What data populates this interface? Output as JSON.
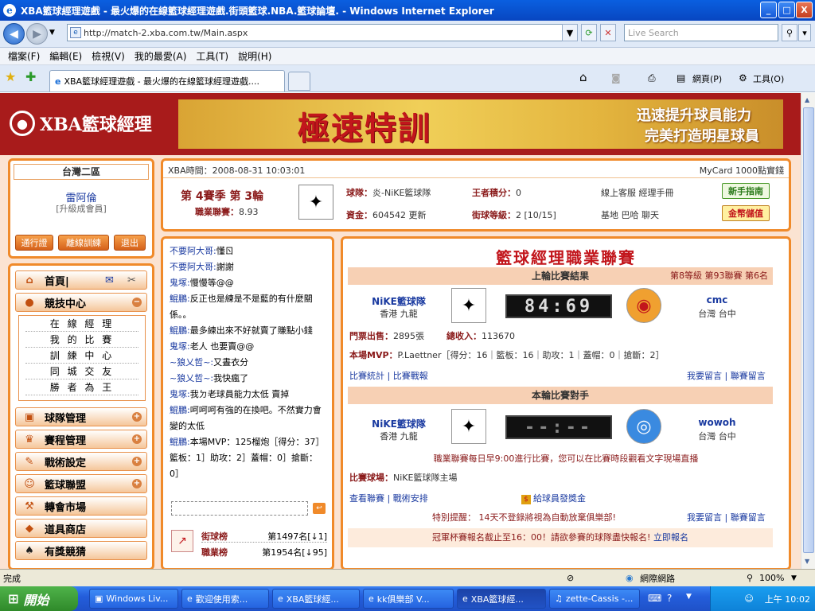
{
  "window": {
    "title": "XBA籃球經理遊戲 - 最火爆的在線籃球經理遊戲.街頭籃球.NBA.籃球論壇. - Windows Internet Explorer",
    "min": "_",
    "max": "□",
    "close": "X"
  },
  "address": {
    "url": "http://match-2.xba.com.tw/Main.aspx",
    "search_placeholder": "Live Search"
  },
  "menubar": [
    "檔案(F)",
    "編輯(E)",
    "檢視(V)",
    "我的最愛(A)",
    "工具(T)",
    "說明(H)"
  ],
  "tab": {
    "label": "XBA籃球經理遊戲 - 最火爆的在線籃球經理遊戲...."
  },
  "toolbar": {
    "page": "網頁(P)",
    "tools": "工具(O)"
  },
  "header": {
    "logo": "XBA籃球經理",
    "banner_main": "極速特訓",
    "banner_line1": "迅速提升球員能力",
    "banner_line2": "完美打造明星球員"
  },
  "user": {
    "region": "台灣二區",
    "name": "雷阿倫",
    "type": "[升級成會員]",
    "buttons": [
      "通行證",
      "離線訓練",
      "退出"
    ]
  },
  "menu": {
    "home": "首頁|",
    "compete": "競技中心",
    "sub": [
      "在 線 經 理",
      "我 的 比 賽",
      "訓 練 中 心",
      "同 城 交 友",
      "勝 者 為 王"
    ],
    "items": [
      "球隊管理",
      "賽程管理",
      "戰術設定",
      "籃球聯盟",
      "轉會市場",
      "道具商店",
      "有獎競猜"
    ]
  },
  "info": {
    "time": "XBA時間：2008-08-31 10:03:01",
    "mycard": "MyCard 1000點實錢",
    "season": "第 4賽季 第 3輪",
    "rating_label": "職業聯賽：",
    "rating": "8.93",
    "team_label": "球隊：",
    "team": "炎-NiKE籃球隊",
    "king_label": "王者積分：",
    "king": "0",
    "service": "線上客服  經理手冊",
    "funds_label": "資金：",
    "funds": "604542",
    "update": "更新",
    "street_label": "街球等級：",
    "street": "2 [10/15]",
    "links2": "基地  巴哈  聊天",
    "guide_btn": "新手指南",
    "gold_btn": "金幣儲值"
  },
  "chat": {
    "messages": [
      {
        "name": "不要阿大哥:",
        "text": "懂ㄖ"
      },
      {
        "name": "不要阿大哥:",
        "text": "謝謝"
      },
      {
        "name": "鬼塚:",
        "text": "慢慢等@@"
      },
      {
        "name": "鯤鵬:",
        "text": "反正也是練是不是藍的有什麼關係。。"
      },
      {
        "name": "鯤鵬:",
        "text": "最多練出來不好就賣了賺點小錢"
      },
      {
        "name": "鬼塚:",
        "text": "老人 也要賣@@"
      },
      {
        "name": "~狼乂哲~:",
        "text": "又晝衣分"
      },
      {
        "name": "~狼乂哲~:",
        "text": "我快瘋了"
      },
      {
        "name": "鬼塚:",
        "text": "我ㄉ老球員能力太低 賣掉"
      },
      {
        "name": "鯤鵬:",
        "text": "呵呵呵有強的在換吧。不然實力會變的太低"
      },
      {
        "name": "鯤鵬:",
        "text": "本場MVP：125榴炮［得分：37］籃板：1］助攻：2］蓋帽：0］搶斷：0］"
      }
    ],
    "send": "↩",
    "rank1_label": "街球榜",
    "rank1": "第1497名[↓1]",
    "rank2_label": "職業榜",
    "rank2": "第1954名[↓95]"
  },
  "league": {
    "title": "籃球經理職業聯賽",
    "last_result": "上輪比賽結果",
    "last_meta": "第8等級  第93聯賽  第6名",
    "home_team": "NiKE籃球隊",
    "home_loc": "香港  九龍",
    "score": "84:69",
    "away_team": "cmc",
    "away_loc": "台灣  台中",
    "ticket_label": "門票出售：",
    "ticket": "2895張",
    "income_label": "總收入：",
    "income": "113670",
    "mvp_label": "本場MVP：",
    "mvp": "P.Laettner［得分：16｜籃板：16｜助攻：1｜蓋帽：0｜搶斷：2］",
    "stats_links": "比賽統計 | 比賽戰報",
    "msg_links": "我要留言 | 聯賽留言",
    "next_title": "本輪比賽對手",
    "next_home": "NiKE籃球隊",
    "next_home_loc": "香港  九龍",
    "next_score": "--:--",
    "next_away": "wowoh",
    "next_away_loc": "台灣  台中",
    "notice": "職業聯賽每日早9:00進行比賽，您可以在比賽時段觀看文字現場直播",
    "venue_label": "比賽球場：",
    "venue": "NiKE籃球隊主場",
    "view_links": "查看聯賽 | 戰術安排",
    "bonus": "給球員發獎金",
    "reminder": "特別提醒： 14天不登錄將視為自動放棄俱樂部!",
    "msg_links2": "我要留言 | 聯賽留言",
    "cup": "冠軍杯賽報名截止至16：00！請欲參賽的球隊盡快報名!",
    "signup": "立即報名"
  },
  "status": {
    "text": "完成",
    "zone": "網際網路",
    "zoom": "100%"
  },
  "taskbar": {
    "start": "開始",
    "tasks": [
      "Windows Liv...",
      "歡迎使用索...",
      "XBA籃球經...",
      "kk俱樂部 V...",
      "XBA籃球經...",
      "zette-Cassis -..."
    ],
    "clock": "上午 10:02"
  },
  "colors": {
    "brand": "#a81b1b",
    "accent": "#f08a2a",
    "link": "#1a3aa0"
  }
}
